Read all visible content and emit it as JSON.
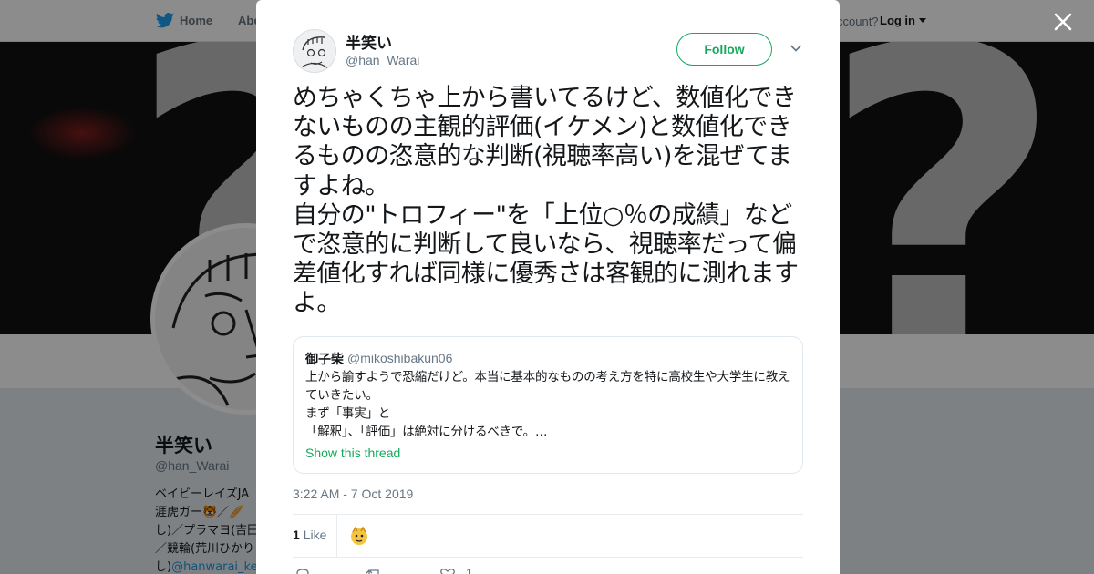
{
  "background": {
    "nav": {
      "home": "Home",
      "about": "Abo",
      "have_account": "ccount?",
      "login": "Log in"
    },
    "profile": {
      "name": "半笑い",
      "handle": "@han_Warai",
      "bio_lines": [
        "ベイビーレイズJA",
        "涯虎ガー🐯／🥖",
        "し)／プラマヨ(吉田",
        "／競輪(荒川ひかり"
      ],
      "bio_link": "@hanwarai_ke",
      "bio_link_prefix": "し)"
    }
  },
  "tweet": {
    "author_name": "半笑い",
    "author_handle": "@han_Warai",
    "follow_label": "Follow",
    "text": "めちゃくちゃ上から書いてるけど、数値化できないものの主観的評価(イケメン)と数値化できるものの恣意的な判断(視聴率高い)を混ぜてますよね。\n自分の\"トロフィー\"を「上位○％の成績」などで恣意的に判断して良いなら、視聴率だって偏差値化すれば同様に優秀さは客観的に測れますよ。",
    "quoted": {
      "name": "御子柴",
      "handle": "@mikoshibakun06",
      "text": "上から諭すようで恐縮だけど。本当に基本的なものの考え方を特に高校生や大学生に教えていきたい。\nまず「事実」と\n「解釈」、「評価」は絶対に分けるべきで。…",
      "show_thread": "Show this thread"
    },
    "timestamp": "3:22 AM - 7 Oct 2019",
    "likes_count": "1",
    "likes_label": "Like",
    "action_like_count": "1"
  },
  "colors": {
    "accent": "#17a85e",
    "twitter_blue": "#1da1f2",
    "text": "#14171a",
    "muted": "#657786"
  },
  "icons": {
    "close": "close-icon",
    "bird": "twitter-bird-icon",
    "menu": "chevron-down-icon"
  }
}
